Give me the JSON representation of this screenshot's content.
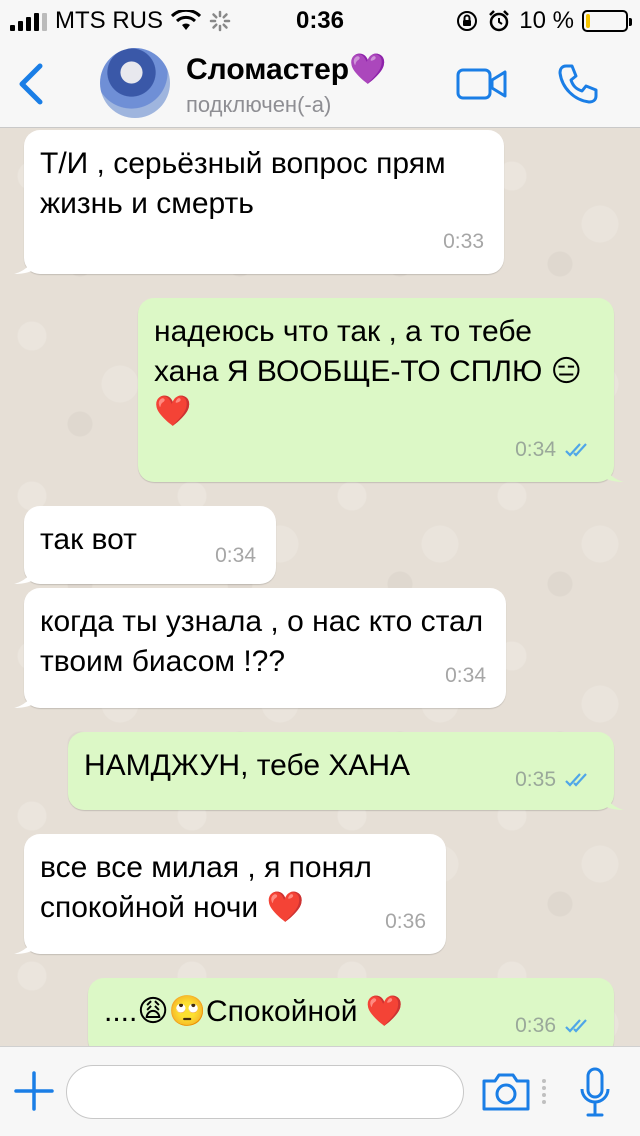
{
  "status_bar": {
    "carrier": "MTS RUS",
    "time": "0:36",
    "battery_percent": "10 %",
    "battery_level": 0.1
  },
  "header": {
    "contact_name": "Сломастер💜",
    "contact_status": "подключен(-а)"
  },
  "messages": [
    {
      "direction": "in",
      "text": "Т/И , серьёзный вопрос прям жизнь и смерть",
      "time": "0:33"
    },
    {
      "direction": "out",
      "text": "надеюсь что так , а то тебе хана Я ВООБЩЕ-ТО СПЛЮ 😑 ❤️",
      "time": "0:34",
      "status": "read"
    },
    {
      "direction": "in",
      "text": "так вот",
      "time": "0:34"
    },
    {
      "direction": "in",
      "text": "когда ты узнала , о нас кто стал твоим биасом !??",
      "time": "0:34"
    },
    {
      "direction": "out",
      "text": "НАМДЖУН, тебе ХАНА",
      "time": "0:35",
      "status": "read"
    },
    {
      "direction": "in",
      "text": "все все милая , я понял спокойной ночи ❤️",
      "time": "0:36"
    },
    {
      "direction": "out",
      "text": "....😩🙄Спокойной ❤️",
      "time": "0:36",
      "status": "read"
    }
  ],
  "input_bar": {
    "placeholder": ""
  },
  "colors": {
    "accent": "#1a7ee6",
    "incoming_bubble": "#ffffff",
    "outgoing_bubble": "#dcf8c6",
    "read_ticks": "#4fa6e8",
    "chat_background": "#e6dfd6"
  },
  "icons": {
    "back": "chevron-left-icon",
    "video": "video-camera-icon",
    "call": "phone-icon",
    "attach": "plus-icon",
    "camera": "camera-icon",
    "mic": "microphone-icon"
  }
}
